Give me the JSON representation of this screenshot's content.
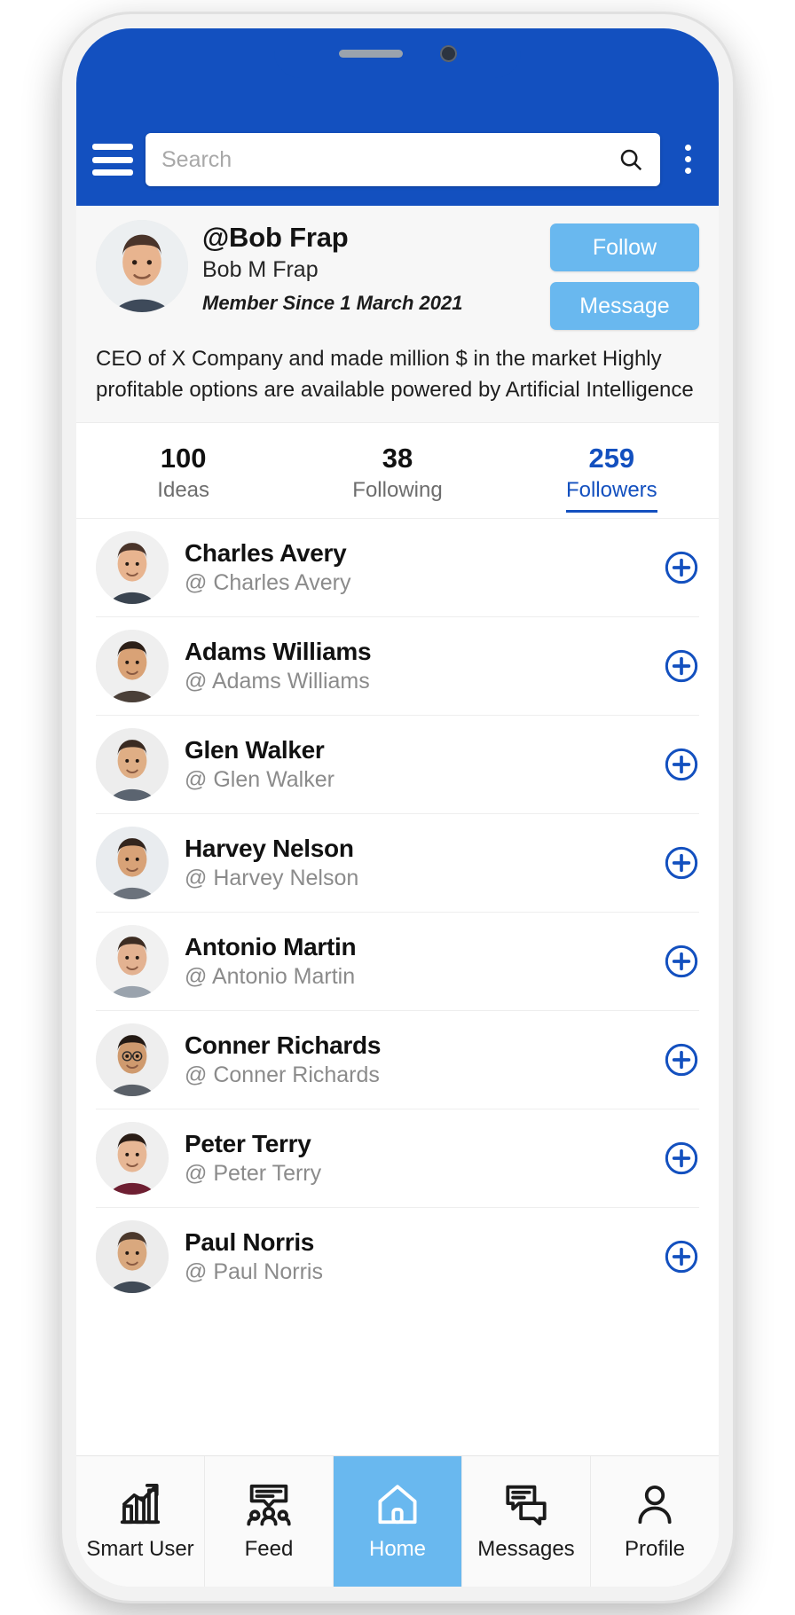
{
  "appbar": {
    "menu_icon": "hamburger-icon",
    "search": {
      "value": "",
      "placeholder": "Search",
      "icon": "search-icon"
    },
    "overflow_icon": "kebab-menu-icon"
  },
  "profile": {
    "handle": "@Bob Frap",
    "full_name": "Bob M Frap",
    "member_since": "Member Since 1 March 2021",
    "bio": "CEO of X Company and made million $ in the market Highly profitable options are available powered by Artificial Intelligence",
    "follow_label": "Follow",
    "message_label": "Message",
    "avatar": "user-avatar"
  },
  "stats": [
    {
      "num": "100",
      "label": "Ideas",
      "active": false
    },
    {
      "num": "38",
      "label": "Following",
      "active": false
    },
    {
      "num": "259",
      "label": "Followers",
      "active": true
    }
  ],
  "followers": [
    {
      "name": "Charles Avery",
      "handle": "@ Charles Avery"
    },
    {
      "name": "Adams Williams",
      "handle": "@ Adams Williams"
    },
    {
      "name": "Glen Walker",
      "handle": "@ Glen Walker"
    },
    {
      "name": "Harvey Nelson",
      "handle": "@ Harvey Nelson"
    },
    {
      "name": "Antonio Martin",
      "handle": "@ Antonio Martin"
    },
    {
      "name": "Conner Richards",
      "handle": "@ Conner Richards"
    },
    {
      "name": "Peter Terry",
      "handle": "@ Peter Terry"
    },
    {
      "name": "Paul Norris",
      "handle": "@ Paul Norris"
    }
  ],
  "tabs": [
    {
      "label": "Smart User",
      "icon": "chart-growth-icon",
      "active": false
    },
    {
      "label": "Feed",
      "icon": "group-feed-icon",
      "active": false
    },
    {
      "label": "Home",
      "icon": "home-icon",
      "active": true
    },
    {
      "label": "Messages",
      "icon": "chat-bubbles-icon",
      "active": false
    },
    {
      "label": "Profile",
      "icon": "person-icon",
      "active": false
    }
  ],
  "colors": {
    "brand_blue": "#1350bf",
    "accent_light_blue": "#69b8ef",
    "text_dark": "#111111",
    "text_muted": "#8b8b8b"
  }
}
